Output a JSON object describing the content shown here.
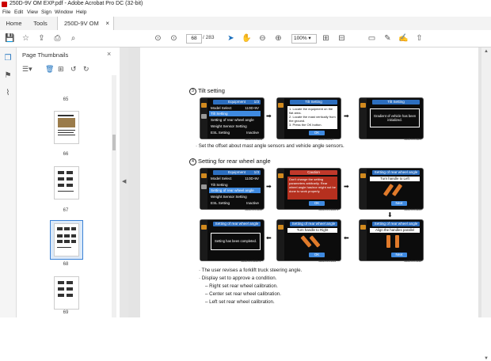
{
  "window": {
    "title": "250D-9V OM EXP.pdf - Adobe Acrobat Pro DC (32-bit)"
  },
  "menu": [
    "File",
    "Edit",
    "View",
    "Sign",
    "Window",
    "Help"
  ],
  "tabs": {
    "home": "Home",
    "tools": "Tools",
    "doc": "250D-9V OM EXP..."
  },
  "toolbar": {
    "page_current": "68",
    "page_total": "/ 283",
    "zoom": "100%"
  },
  "thumbnails": {
    "header": "Page Thumbnails",
    "labels": [
      "65",
      "66",
      "67",
      "68",
      "69"
    ],
    "selected": "68"
  },
  "content": {
    "section3": {
      "num": "3",
      "title": "Tilt setting"
    },
    "section3_note": "Set the offset about mast angle sensors and vehicle angle sensors.",
    "section4": {
      "num": "4",
      "title": "Setting for rear wheel angle"
    },
    "notes": [
      "The user revises a forklift truck steering angle.",
      "Display set to approve a condition.",
      "Right set rear wheel calibration.",
      "Center set rear wheel calibration.",
      "Left set rear wheel calibration."
    ],
    "screens": {
      "equip": {
        "title": "Equipment",
        "page": "1/3",
        "rows": [
          "Model Select",
          "Tilt Setting",
          "Setting of rear wheel angle",
          "Weight Sensor Setting",
          "ESL Setting"
        ],
        "model_val": "110D-9V",
        "esl_val": "Inactive"
      },
      "tilt2": {
        "title": "Tilt Setting",
        "text": "1. Locate the equipment on the flat area.\n2. Locate the mast vertically from the ground.\n3. Press the OK button.",
        "ok": "OK"
      },
      "tilt3": {
        "title": "Tilt Setting",
        "text": "Gradient of vehicle has been initialized."
      },
      "caution": {
        "title": "Caution",
        "text": "Don't change the setting parameters arbitrarily. Rear wheel angle has/nor might not be done to work properly.",
        "ok": "OK"
      },
      "left": {
        "title": "Setting of rear wheel angle",
        "cap": "Turn handle to Left",
        "btn": "Next"
      },
      "right": {
        "title": "Setting of rear wheel angle",
        "cap": "Turn handle to Right",
        "btn": "OK"
      },
      "parallel": {
        "title": "Setting of rear wheel angle",
        "cap": "Align the handles parallel",
        "btn": "Next"
      },
      "done": {
        "title": "Setting of rear wheel angle",
        "text": "Setting has been completed."
      }
    },
    "codes": [
      "160D9VCD28",
      "500D9CD27",
      "160D9VCD29",
      "160D9VCD30",
      "160D9VCD30-1",
      "160D9VCD31",
      "160D9VCD30-1",
      "160D9VCD33",
      "160D9VCD32"
    ]
  }
}
